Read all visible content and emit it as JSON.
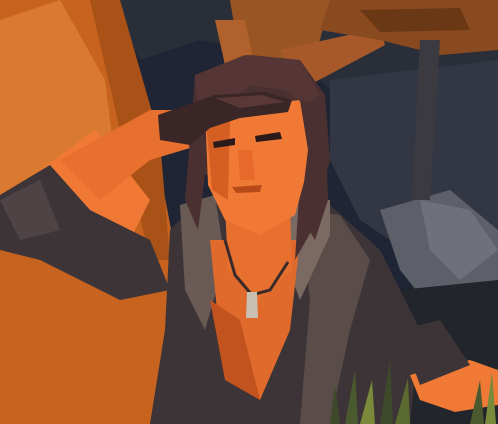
{
  "scene": {
    "palette": {
      "night_sky": "#1f2534",
      "dark_rock": "#2c2f38",
      "grey_rock": "#5d6068",
      "orange_wall": "#c7631f",
      "wood": "#8a4a1f",
      "skin_lit": "#f07a35",
      "skin_shadow": "#c2521e",
      "hair": "#4a3030",
      "glove": "#3a2626",
      "jacket": "#3c3436",
      "jacket_light": "#6a5a55",
      "shirt": "#e06a2c",
      "grass": "#3f4a2a",
      "grass_light": "#7a8a3a"
    },
    "elements": [
      "rock-cave-background",
      "orange-rock-wall",
      "tree-trunk",
      "wooden-branch",
      "character-explorer",
      "necklace-pendant",
      "grass-tufts"
    ]
  }
}
